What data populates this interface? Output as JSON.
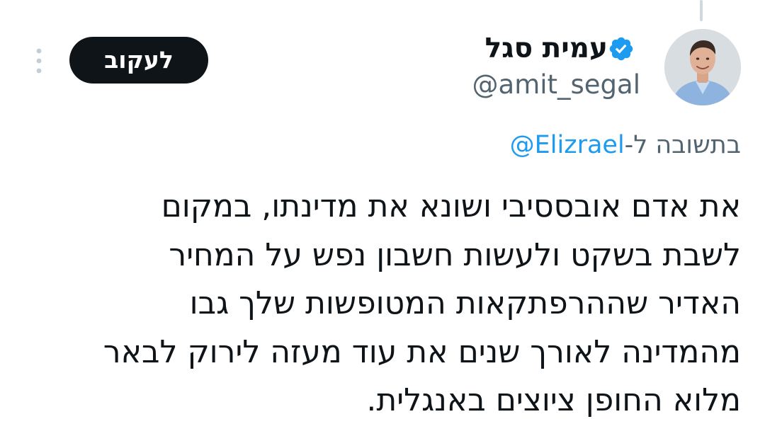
{
  "author": {
    "display_name": "עמית סגל",
    "handle": "@amit_segal",
    "verified": true,
    "verified_color": "#1d9bf0",
    "avatar_icon": "profile-photo"
  },
  "follow_button": {
    "label": "לעקוב"
  },
  "more_menu": {
    "icon": "vertical-dots-icon"
  },
  "reply_context": {
    "prefix": "בתשובה ל-",
    "mention": "@Elizrael"
  },
  "tweet": {
    "lines": [
      "את אדם אובססיבי ושונא את מדינתו, במקום",
      "לשבת בשקט ולעשות חשבון נפש על המחיר",
      "האדיר שההרפתקאות המטופשות שלך גבו",
      "מהמדינה לאורך שנים את עוד מעזה לירוק לבאר",
      "מלוא החופן ציוצים באנגלית."
    ]
  },
  "colors": {
    "text_primary": "#0f1419",
    "text_secondary": "#536471",
    "link": "#1d9bf0",
    "button_bg": "#0f1419",
    "button_text": "#ffffff",
    "thread_line": "#cfd9de"
  }
}
